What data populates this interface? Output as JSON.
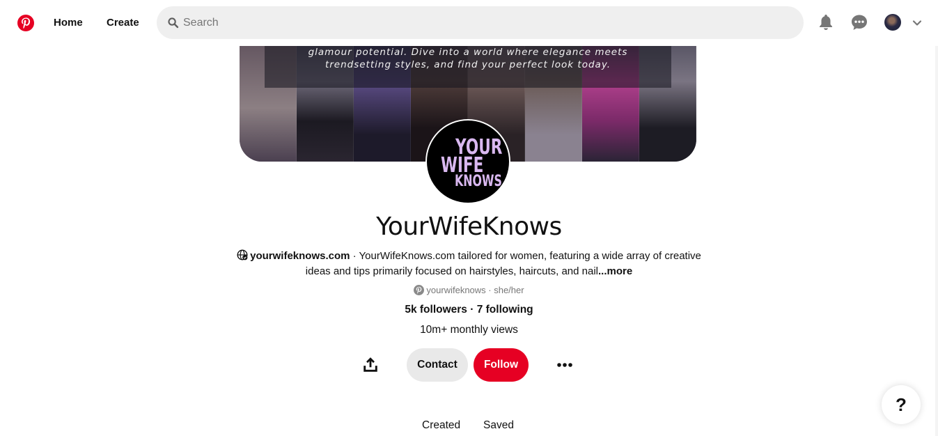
{
  "header": {
    "logo": "pinterest-logo",
    "nav": [
      {
        "label": "Home"
      },
      {
        "label": "Create"
      }
    ],
    "search": {
      "placeholder": "Search",
      "value": ""
    },
    "icons": [
      "bell-icon",
      "chat-icon",
      "avatar",
      "chevron-down-icon"
    ]
  },
  "cover": {
    "text": "glamour potential. Dive into a world where elegance meets trendsetting styles, and find your perfect look today."
  },
  "profile": {
    "avatar_text": [
      "YOUR",
      "WIFE",
      "KNOWS"
    ],
    "name": "YourWifeKnows",
    "website": "yourwifeknows.com",
    "bio_sep": " · ",
    "bio": "YourWifeKnows.com tailored for women, featuring a wide array of creative ideas and tips primarily focused on hairstyles, haircuts, and nail",
    "more": "...more",
    "handle": "yourwifeknows",
    "pronouns": " · she/her",
    "followers": "5k followers",
    "following": "7 following",
    "follow_sep": " · ",
    "monthly_views": "10m+ monthly views"
  },
  "actions": {
    "contact": "Contact",
    "follow": "Follow"
  },
  "tabs": [
    {
      "label": "Created"
    },
    {
      "label": "Saved"
    }
  ],
  "help": {
    "label": "?"
  },
  "colors": {
    "brand": "#e60023",
    "search_bg": "#efefef",
    "contact_bg": "#e9e9e9",
    "avatar_text": "#d9b8f0"
  }
}
